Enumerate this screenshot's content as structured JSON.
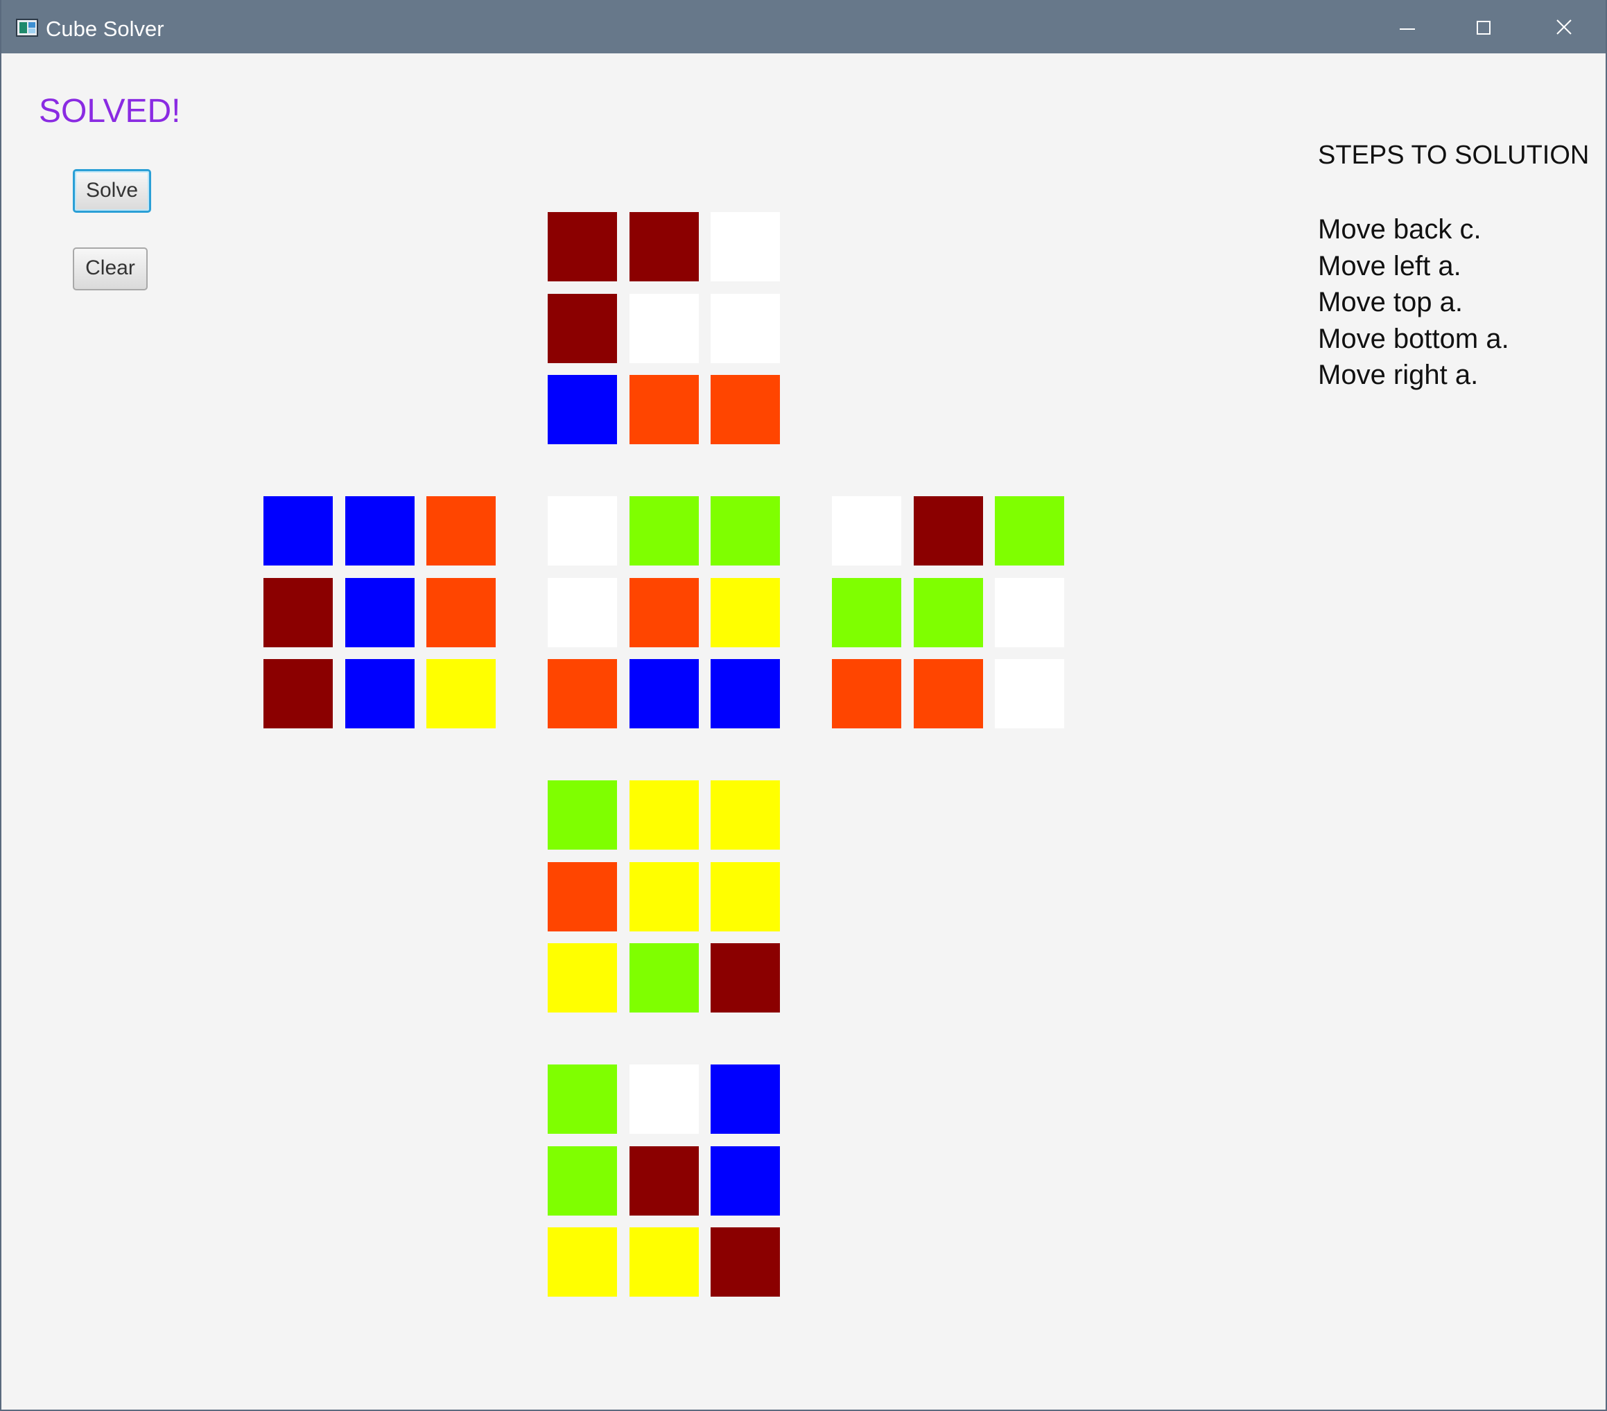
{
  "window": {
    "title": "Cube Solver",
    "app_icon": "app-window-icon",
    "controls": [
      {
        "name": "minimize-button",
        "icon": "minimize-icon"
      },
      {
        "name": "maximize-button",
        "icon": "maximize-icon"
      },
      {
        "name": "close-button",
        "icon": "close-icon"
      }
    ]
  },
  "status": {
    "text": "SOLVED!",
    "color": "#8a2be2"
  },
  "buttons": {
    "solve_label": "Solve",
    "clear_label": "Clear"
  },
  "steps": {
    "title": "STEPS TO SOLUTION",
    "items": [
      "Move back c.",
      "Move left a.",
      "Move top a.",
      "Move bottom a.",
      "Move right a."
    ]
  },
  "palette": {
    "R": "#8b0000",
    "W": "#ffffff",
    "B": "#0000ff",
    "O": "#ff4500",
    "G": "#7fff00",
    "Y": "#ffff00"
  },
  "cube": {
    "faces": [
      {
        "name": "top",
        "cells": [
          "R",
          "R",
          "W",
          "R",
          "W",
          "W",
          "B",
          "O",
          "O"
        ]
      },
      {
        "name": "left",
        "cells": [
          "B",
          "B",
          "O",
          "R",
          "B",
          "O",
          "R",
          "B",
          "Y"
        ]
      },
      {
        "name": "front",
        "cells": [
          "W",
          "G",
          "G",
          "W",
          "O",
          "Y",
          "O",
          "B",
          "B"
        ]
      },
      {
        "name": "right",
        "cells": [
          "W",
          "R",
          "G",
          "G",
          "G",
          "W",
          "O",
          "O",
          "W"
        ]
      },
      {
        "name": "bottom",
        "cells": [
          "G",
          "Y",
          "Y",
          "O",
          "Y",
          "Y",
          "Y",
          "G",
          "R"
        ]
      },
      {
        "name": "back",
        "cells": [
          "G",
          "W",
          "B",
          "G",
          "R",
          "B",
          "Y",
          "Y",
          "R"
        ]
      }
    ]
  }
}
